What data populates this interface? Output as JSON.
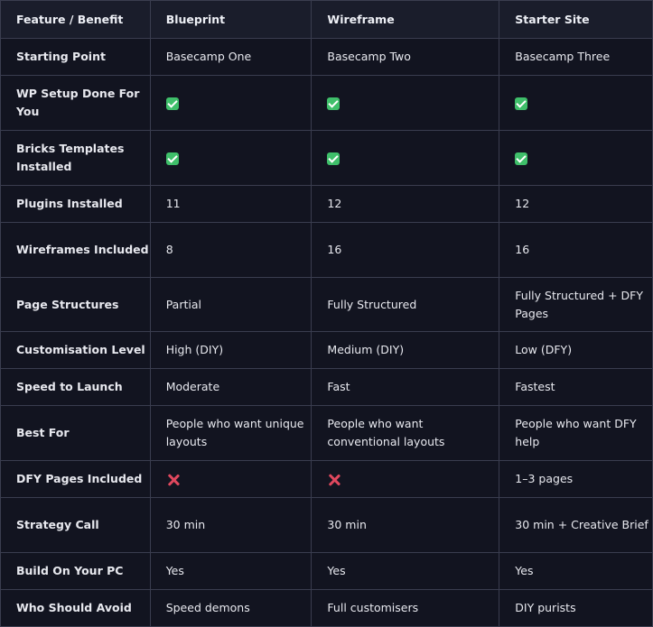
{
  "table": {
    "headers": [
      "Feature / Benefit",
      "Blueprint",
      "Wireframe",
      "Starter Site"
    ],
    "rows": [
      {
        "feature": "Starting Point",
        "cells": [
          "Basecamp One",
          "Basecamp Two",
          "Basecamp Three"
        ]
      },
      {
        "feature": "WP Setup Done For You",
        "cells": [
          "check",
          "check",
          "check"
        ]
      },
      {
        "feature": "Bricks Templates Installed",
        "cells": [
          "check",
          "check",
          "check"
        ]
      },
      {
        "feature": "Plugins Installed",
        "cells": [
          "11",
          "12",
          "12"
        ]
      },
      {
        "feature": "Wireframes Included",
        "cells": [
          "8",
          "16",
          "16"
        ]
      },
      {
        "feature": "Page Structures",
        "cells": [
          "Partial",
          "Fully Structured",
          "Fully Structured + DFY Pages"
        ]
      },
      {
        "feature": "Customisation Level",
        "cells": [
          "High (DIY)",
          "Medium (DIY)",
          "Low (DFY)"
        ]
      },
      {
        "feature": "Speed to Launch",
        "cells": [
          "Moderate",
          "Fast",
          "Fastest"
        ]
      },
      {
        "feature": "Best For",
        "cells": [
          "People who want unique layouts",
          "People who want conventional layouts",
          "People who want DFY help"
        ]
      },
      {
        "feature": "DFY Pages Included",
        "cells": [
          "cross",
          "cross",
          "1–3 pages"
        ]
      },
      {
        "feature": "Strategy Call",
        "cells": [
          "30 min",
          "30 min",
          "30 min + Creative Brief"
        ]
      },
      {
        "feature": "Build On Your PC",
        "cells": [
          "Yes",
          "Yes",
          "Yes"
        ]
      },
      {
        "feature": "Who Should Avoid",
        "cells": [
          "Speed demons",
          "Full customisers",
          "DIY purists"
        ]
      }
    ]
  },
  "icons": {
    "check": "check-mark-icon",
    "cross": "cross-mark-icon"
  },
  "colors": {
    "background": "#11131c",
    "header_background": "#1a1d2b",
    "border": "#3a3d4f",
    "check": "#3fbf6a",
    "cross": "#e0485e"
  }
}
